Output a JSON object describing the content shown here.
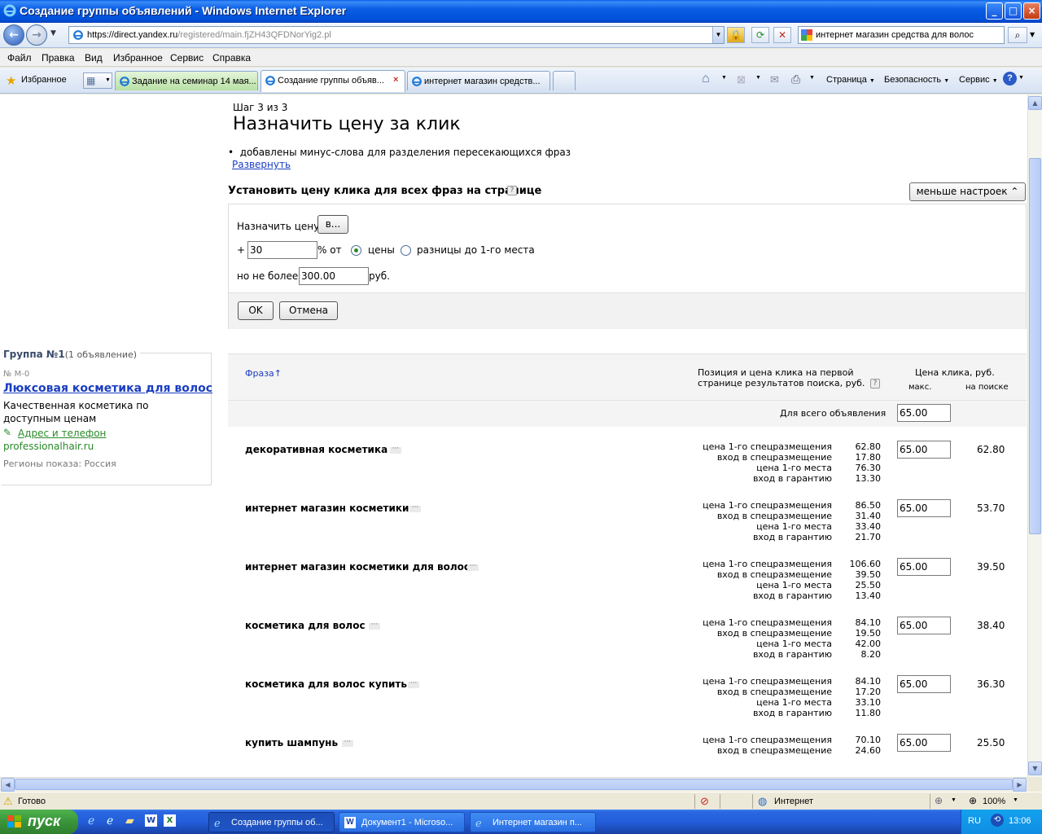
{
  "window": {
    "title": "Создание группы объявлений - Windows Internet Explorer",
    "buttons": {
      "minimize": "_",
      "maximize": "□",
      "close": "×"
    }
  },
  "address_bar": {
    "url_prefix": "https://",
    "url_domain": "direct.yandex.ru",
    "url_path": "/registered/main.fjZH43QFDNorYig2.pl",
    "search_value": "интернет магазин средства для волос"
  },
  "menu": [
    "Файл",
    "Правка",
    "Вид",
    "Избранное",
    "Сервис",
    "Справка"
  ],
  "favorites_bar": {
    "favorites_label": "Избранное",
    "tabs": [
      {
        "label": "Задание на семинар 14 мая...",
        "state": "green"
      },
      {
        "label": "Создание группы объяв...",
        "state": "active"
      },
      {
        "label": "интернет магазин средств...",
        "state": "normal"
      }
    ],
    "commands": [
      "Страница",
      "Безопасность",
      "Сервис"
    ]
  },
  "page": {
    "step": "Шаг 3 из 3",
    "heading": "Назначить цену за клик",
    "bullet": "добавлены минус-слова для разделения пересекающихся фраз",
    "expand_link": "Развернуть",
    "set_all_title": "Установить цену клика для всех фраз на странице",
    "less_settings": "меньше настроек",
    "form": {
      "assign_label": "Назначить цену",
      "assign_button": "в...",
      "plus": "+",
      "percent_value": "30",
      "percent_of": "% от",
      "radio_price": "цены",
      "radio_diff": "разницы до 1-го места",
      "not_more": "но не более",
      "max_value": "300.00",
      "currency": "руб.",
      "ok": "OK",
      "cancel": "Отмена"
    },
    "ad_card": {
      "group": "Группа №1",
      "group_count": "(1 объявление)",
      "number": "№ M-0",
      "title": "Люксовая косметика для волос",
      "text": "Качественная косметика по доступным ценам",
      "address_link": "Адрес и телефон",
      "domain": "professionalhair.ru",
      "regions": "Регионы показа: Россия"
    },
    "table": {
      "col_phrase": "Фраза",
      "sort_arrow": "↑",
      "col_position_line1": "Позиция и цена клика на первой",
      "col_position_line2": "странице результатов поиска, руб.",
      "col_price": "Цена клика, руб.",
      "col_max": "макс.",
      "col_search": "на поиске",
      "whole_ad_label": "Для всего объявления",
      "whole_ad_value": "65.00",
      "row_labels": [
        "цена 1-го спецразмещения",
        "вход в спецразмещение",
        "цена 1-го места",
        "вход в гарантию"
      ],
      "rows": [
        {
          "phrase": "декоративная косметика",
          "vals": [
            "62.80",
            "17.80",
            "76.30",
            "13.30"
          ],
          "max": "65.00",
          "search": "62.80"
        },
        {
          "phrase": "интернет магазин косметики",
          "vals": [
            "86.50",
            "31.40",
            "33.40",
            "21.70"
          ],
          "max": "65.00",
          "search": "53.70"
        },
        {
          "phrase": "интернет магазин косметики для волос",
          "vals": [
            "106.60",
            "39.50",
            "25.50",
            "13.40"
          ],
          "max": "65.00",
          "search": "39.50"
        },
        {
          "phrase": "косметика для волос",
          "vals": [
            "84.10",
            "19.50",
            "42.00",
            "8.20"
          ],
          "max": "65.00",
          "search": "38.40"
        },
        {
          "phrase": "косметика для волос купить",
          "vals": [
            "84.10",
            "17.20",
            "33.10",
            "11.80"
          ],
          "max": "65.00",
          "search": "36.30"
        },
        {
          "phrase": "купить шампунь",
          "vals": [
            "70.10",
            "24.60",
            "",
            ""
          ],
          "max": "65.00",
          "search": "25.50"
        }
      ]
    }
  },
  "status_bar": {
    "status": "Готово",
    "zone": "Интернет",
    "zoom": "100%"
  },
  "taskbar": {
    "start": "пуск",
    "buttons": [
      "Создание группы об...",
      "Документ1 - Microso...",
      "Интернет магазин п..."
    ],
    "lang": "RU",
    "clock": "13:06"
  },
  "colors": {
    "link": "#1a3dc1",
    "title_bar": "#0a5de4",
    "taskbar": "#245edb",
    "start": "#3a943a"
  }
}
